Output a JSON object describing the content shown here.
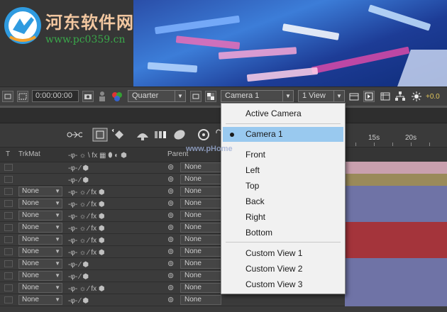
{
  "watermark": {
    "title": "河东软件网",
    "url": "www.pc0359.cn"
  },
  "viewer_toolbar": {
    "timecode": "0:00:00:00",
    "resolution": "Quarter",
    "camera_select": "Camera 1",
    "view_layout": "1 View",
    "exposure": "+0.0"
  },
  "timeline_tab_label": "www.pHome",
  "columns": {
    "t": "T",
    "trkmat": "TrkMat",
    "parent": "Parent"
  },
  "ruler": {
    "ticks": [
      "15s",
      "20s"
    ]
  },
  "layers": [
    {
      "trkmat": "",
      "parent": "None",
      "fx": false,
      "color": "#c9a0ae"
    },
    {
      "trkmat": "",
      "parent": "None",
      "fx": false,
      "color": "#9a8a5a"
    },
    {
      "trkmat": "None",
      "parent": "None",
      "fx": true,
      "color": "#6f73a6"
    },
    {
      "trkmat": "None",
      "parent": "None",
      "fx": true,
      "color": "#6f73a6"
    },
    {
      "trkmat": "None",
      "parent": "None",
      "fx": true,
      "color": "#6f73a6"
    },
    {
      "trkmat": "None",
      "parent": "None",
      "fx": true,
      "color": "#a4343b"
    },
    {
      "trkmat": "None",
      "parent": "None",
      "fx": true,
      "color": "#a4343b"
    },
    {
      "trkmat": "None",
      "parent": "None",
      "fx": true,
      "color": "#a4343b"
    },
    {
      "trkmat": "None",
      "parent": "None",
      "fx": false,
      "color": "#6f73a6"
    },
    {
      "trkmat": "None",
      "parent": "None",
      "fx": false,
      "color": "#6f73a6"
    },
    {
      "trkmat": "None",
      "parent": "None",
      "fx": true,
      "color": "#6f73a6"
    },
    {
      "trkmat": "None",
      "parent": "None",
      "fx": false,
      "color": "#6f73a6"
    }
  ],
  "camera_menu": {
    "items": [
      {
        "label": "Active Camera",
        "selected": false
      },
      {
        "label": "Camera 1",
        "selected": true
      },
      {
        "label": "Front",
        "selected": false
      },
      {
        "label": "Left",
        "selected": false
      },
      {
        "label": "Top",
        "selected": false
      },
      {
        "label": "Back",
        "selected": false
      },
      {
        "label": "Right",
        "selected": false
      },
      {
        "label": "Bottom",
        "selected": false
      },
      {
        "label": "Custom View 1",
        "selected": false
      },
      {
        "label": "Custom View 2",
        "selected": false
      },
      {
        "label": "Custom View 3",
        "selected": false
      }
    ]
  }
}
